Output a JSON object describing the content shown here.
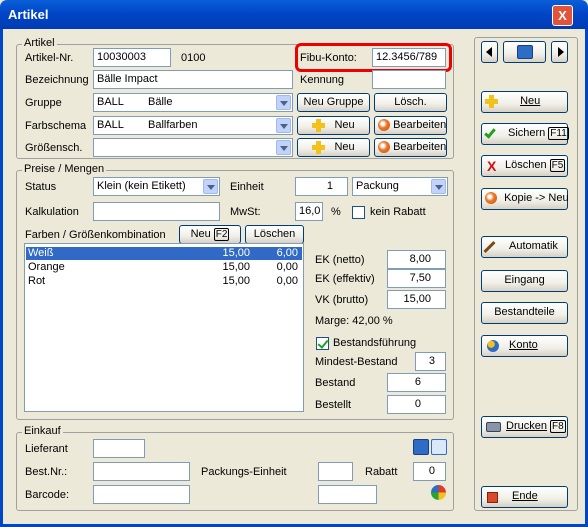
{
  "window": {
    "title": "Artikel",
    "close_glyph": "X"
  },
  "artikel": {
    "legend": "Artikel",
    "artikel_nr_label": "Artikel-Nr.",
    "artikel_nr_value": "10030003",
    "artikel_nr_suffix": "0100",
    "fibu_label": "Fibu-Konto:",
    "fibu_value": "12.3456/789",
    "bezeichnung_label": "Bezeichnung",
    "bezeichnung_value": "Bälle Impact",
    "kennung_label": "Kennung",
    "kennung_value": "",
    "gruppe_label": "Gruppe",
    "gruppe_code": "BALL",
    "gruppe_name": "Bälle",
    "neu_gruppe_btn": "Neu Gruppe",
    "loesch_btn": "Lösch.",
    "farbschema_label": "Farbschema",
    "farbschema_code": "BALL",
    "farbschema_name": "Ballfarben",
    "neu_btn": "Neu",
    "bearbeiten_btn": "Bearbeiten",
    "groessen_label": "Größensch.",
    "groessen_code": "",
    "groessen_name": "",
    "neu_btn2": "Neu",
    "bearbeiten_btn2": "Bearbeiten"
  },
  "preise": {
    "legend": "Preise / Mengen",
    "status_label": "Status",
    "status_value": "Klein (kein Etikett)",
    "einheit_label": "Einheit",
    "einheit_qty": "1",
    "einheit_value": "Packung",
    "kalkulation_label": "Kalkulation",
    "kalkulation_value": "",
    "mwst_label": "MwSt:",
    "mwst_value": "16,0",
    "mwst_unit": "%",
    "kein_rabatt_label": "kein Rabatt",
    "farben_label": "Farben / Größenkombination",
    "neu_label": "Neu",
    "neu_key": "F2",
    "loeschen_label": "Löschen",
    "rows": [
      {
        "name": "Weiß",
        "a": "15,00",
        "b": "6,00"
      },
      {
        "name": "Orange",
        "a": "15,00",
        "b": "0,00"
      },
      {
        "name": "Rot",
        "a": "15,00",
        "b": "0,00"
      }
    ],
    "ek_netto_label": "EK (netto)",
    "ek_netto_value": "8,00",
    "ek_eff_label": "EK (effektiv)",
    "ek_eff_value": "7,50",
    "vk_label": "VK (brutto)",
    "vk_value": "15,00",
    "marge_text": "Marge: 42,00 %",
    "bestandsfuehrung_label": "Bestandsführung",
    "mindest_label": "Mindest-Bestand",
    "mindest_value": "3",
    "bestand_label": "Bestand",
    "bestand_value": "6",
    "bestellt_label": "Bestellt",
    "bestellt_value": "0"
  },
  "einkauf": {
    "legend": "Einkauf",
    "lieferant_label": "Lieferant",
    "lieferant_value": "",
    "bestnr_label": "Best.Nr.:",
    "bestnr_value": "",
    "packungs_label": "Packungs-Einheit",
    "packungs_value": "",
    "rabatt_label": "Rabatt",
    "rabatt_value": "0",
    "barcode_label": "Barcode:",
    "barcode_value": "",
    "barcode2_value": ""
  },
  "sidebar": {
    "neu": "Neu",
    "sichern": "Sichern",
    "sichern_key": "F11",
    "loeschen": "Löschen",
    "loeschen_key": "F5",
    "kopie": "Kopie -> Neu",
    "automatik": "Automatik",
    "eingang": "Eingang",
    "bestandteile": "Bestandteile",
    "konto": "Konto",
    "drucken": "Drucken",
    "drucken_key": "F8",
    "ende": "Ende"
  }
}
